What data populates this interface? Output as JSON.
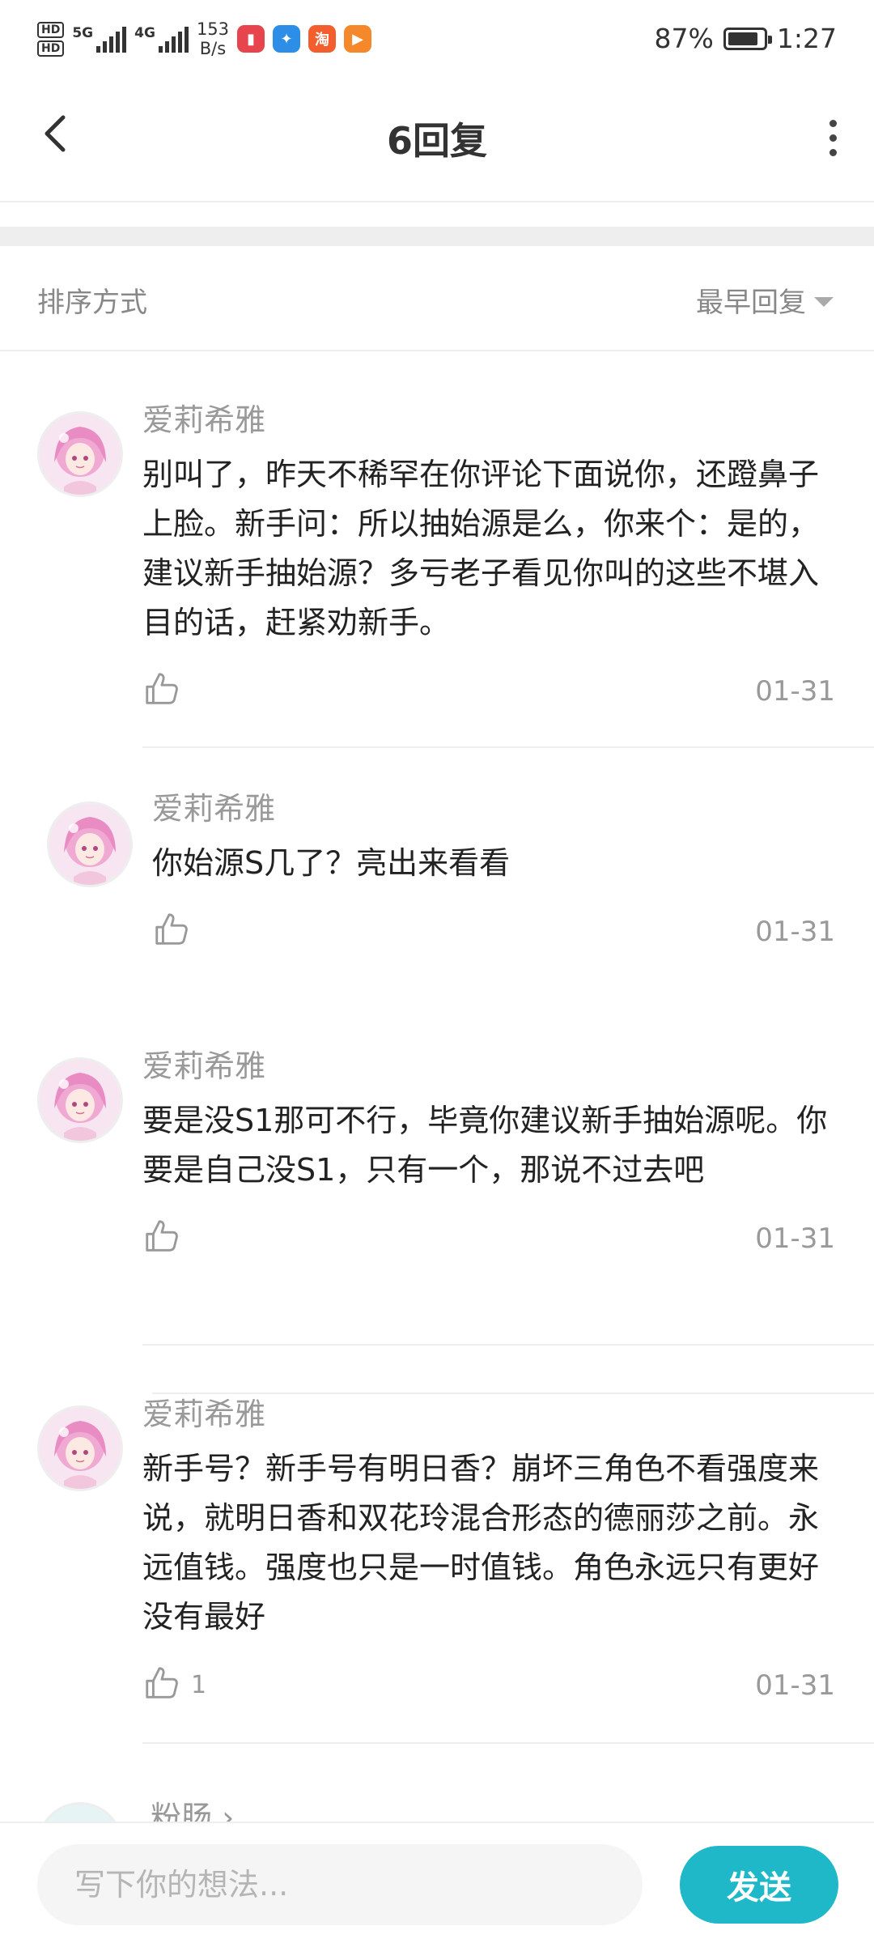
{
  "status_bar": {
    "hd_top": "HD",
    "hd_bottom": "HD",
    "net1": "5G",
    "net2": "4G",
    "speed_value": "153",
    "speed_unit": "B/s",
    "battery": "87%",
    "battery_level": 0.87,
    "time": "1:27",
    "app_icons": [
      "red-book-app-icon",
      "blue-compass-app-icon",
      "taobao-app-icon",
      "orange-play-app-icon"
    ],
    "app_icon_colors": [
      "#e8444e",
      "#2d8ee8",
      "#f25e2e",
      "#f5882a"
    ],
    "app_icon_glyphs": [
      "▮",
      "✦",
      "淘",
      "▶"
    ]
  },
  "header": {
    "title": "6回复"
  },
  "sort": {
    "label": "排序方式",
    "selected": "最早回复"
  },
  "comments": [
    {
      "user": "爱莉希雅",
      "text": "别叫了，昨天不稀罕在你评论下面说你，还蹬鼻子上脸。新手问：所以抽始源是么，你来个：是的，建议新手抽始源？多亏老子看见你叫的这些不堪入目的话，赶紧劝新手。",
      "likes": "",
      "date": "01-31"
    },
    {
      "user": "爱莉希雅",
      "text": "你始源S几了？亮出来看看",
      "likes": "",
      "date": "01-31"
    },
    {
      "user": "爱莉希雅",
      "text": "要是没S1那可不行，毕竟你建议新手抽始源呢。你要是自己没S1，只有一个，那说不过去吧",
      "likes": "",
      "date": "01-31"
    },
    {
      "user": "爱莉希雅",
      "text": "新手号？新手号有明日香？崩坏三角色不看强度来说，就明日香和双花玲混合形态的德丽莎之前。永远值钱。强度也只是一时值钱。角色永远只有更好没有最好",
      "likes": "1",
      "date": "01-31"
    }
  ],
  "partial_comment": {
    "user": "粉肠 ›"
  },
  "composer": {
    "placeholder": "写下你的想法...",
    "value": "",
    "send_label": "发送"
  },
  "colors": {
    "accent": "#1fb8c9",
    "muted_text": "#999999",
    "divider": "#eeeeee"
  }
}
